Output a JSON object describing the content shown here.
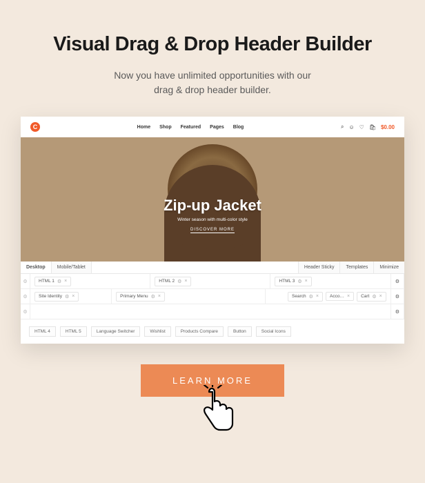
{
  "title": "Visual Drag & Drop Header Builder",
  "subtitle_line1": "Now you have unlimited opportunities with our",
  "subtitle_line2": "drag & drop header builder.",
  "site": {
    "logo_letter": "C",
    "menu": [
      "Home",
      "Shop",
      "Featured",
      "Pages",
      "Blog"
    ],
    "cart_price": "$0.00"
  },
  "hero": {
    "headline": "Zip-up Jacket",
    "sub": "Winter season with multi-color style",
    "cta": "DISCOVER MORE"
  },
  "builder": {
    "tabs": {
      "desktop": "Desktop",
      "mobile": "Mobile/Tablet"
    },
    "tools": {
      "sticky": "Header Sticky",
      "templates": "Templates",
      "minimize": "Minimize"
    },
    "row1": {
      "c1": "HTML 1",
      "c2": "HTML 2",
      "c3": "HTML 3"
    },
    "row2": {
      "c1": "Site Identity",
      "c2": "Primary Menu",
      "c3a": "Search",
      "c3b": "Acco…",
      "c3c": "Cart"
    },
    "palette": [
      "HTML 4",
      "HTML 5",
      "Language Switcher",
      "Wishlist",
      "Products Compare",
      "Button",
      "Social Icons"
    ]
  },
  "cta_label": "LEARN MORE"
}
